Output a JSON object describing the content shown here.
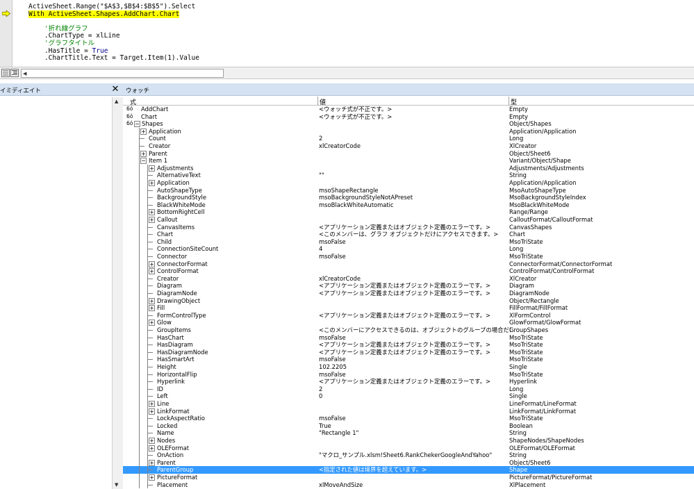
{
  "code": {
    "lines": [
      {
        "text": "ActiveSheet.Range(\"$A$3,$B$4:$B$5\").Select",
        "kind": "normal",
        "indent": 0
      },
      {
        "text": "With ActiveSheet.Shapes.AddChart.Chart",
        "kind": "highlight",
        "indent": 0
      },
      {
        "text": "",
        "kind": "normal",
        "indent": 0
      },
      {
        "text": "'折れ線グラフ",
        "kind": "comment",
        "indent": 4
      },
      {
        "text": ".ChartType = xlLine",
        "kind": "normal",
        "indent": 4
      },
      {
        "text": "'グラフタイトル",
        "kind": "comment",
        "indent": 4
      },
      {
        "text": ".HasTitle = True",
        "kind": "hastitle",
        "indent": 4
      },
      {
        "text": ".ChartTitle.Text = Target.Item(1).Value",
        "kind": "normal",
        "indent": 4
      }
    ],
    "exec_arrow_color": "#ffff00"
  },
  "immediate": {
    "title": "イミディエイト",
    "close_glyph": "✕"
  },
  "watch": {
    "title": "ウォッチ",
    "columns": [
      "式",
      "値",
      "型"
    ],
    "selected_color": "#3399ff",
    "rows": [
      {
        "expr": "AddChart",
        "value": "<ウォッチ式が不正です。>",
        "type": "Empty",
        "depth": 0,
        "icon": "glasses",
        "box": ""
      },
      {
        "expr": "Chart",
        "value": "<ウォッチ式が不正です。>",
        "type": "Empty",
        "depth": 0,
        "icon": "glasses",
        "box": ""
      },
      {
        "expr": "Shapes",
        "value": "",
        "type": "Object/Shapes",
        "depth": 0,
        "icon": "glasses",
        "box": "−"
      },
      {
        "expr": "Application",
        "value": "",
        "type": "Application/Application",
        "depth": 1,
        "box": "+"
      },
      {
        "expr": "Count",
        "value": "2",
        "type": "Long",
        "depth": 1,
        "box": ""
      },
      {
        "expr": "Creator",
        "value": "xlCreatorCode",
        "type": "XlCreator",
        "depth": 1,
        "box": ""
      },
      {
        "expr": "Parent",
        "value": "",
        "type": "Object/Sheet6",
        "depth": 1,
        "box": "+"
      },
      {
        "expr": "Item 1",
        "value": "",
        "type": "Variant/Object/Shape",
        "depth": 1,
        "box": "−"
      },
      {
        "expr": "Adjustments",
        "value": "",
        "type": "Adjustments/Adjustments",
        "depth": 2,
        "box": "+"
      },
      {
        "expr": "AlternativeText",
        "value": "\"\"",
        "type": "String",
        "depth": 2,
        "box": ""
      },
      {
        "expr": "Application",
        "value": "",
        "type": "Application/Application",
        "depth": 2,
        "box": "+"
      },
      {
        "expr": "AutoShapeType",
        "value": "msoShapeRectangle",
        "type": "MsoAutoShapeType",
        "depth": 2,
        "box": ""
      },
      {
        "expr": "BackgroundStyle",
        "value": "msoBackgroundStyleNotAPreset",
        "type": "MsoBackgroundStyleIndex",
        "depth": 2,
        "box": ""
      },
      {
        "expr": "BlackWhiteMode",
        "value": "msoBlackWhiteAutomatic",
        "type": "MsoBlackWhiteMode",
        "depth": 2,
        "box": ""
      },
      {
        "expr": "BottomRightCell",
        "value": "",
        "type": "Range/Range",
        "depth": 2,
        "box": "+"
      },
      {
        "expr": "Callout",
        "value": "",
        "type": "CalloutFormat/CalloutFormat",
        "depth": 2,
        "box": "+"
      },
      {
        "expr": "CanvasItems",
        "value": "<アプリケーション定義またはオブジェクト定義のエラーです。>",
        "type": "CanvasShapes",
        "depth": 2,
        "box": ""
      },
      {
        "expr": "Chart",
        "value": "<このメンバーは、グラフ オブジェクトだけにアクセスできます。>",
        "type": "Chart",
        "depth": 2,
        "box": ""
      },
      {
        "expr": "Child",
        "value": "msoFalse",
        "type": "MsoTriState",
        "depth": 2,
        "box": ""
      },
      {
        "expr": "ConnectionSiteCount",
        "value": "4",
        "type": "Long",
        "depth": 2,
        "box": ""
      },
      {
        "expr": "Connector",
        "value": "msoFalse",
        "type": "MsoTriState",
        "depth": 2,
        "box": ""
      },
      {
        "expr": "ConnectorFormat",
        "value": "",
        "type": "ConnectorFormat/ConnectorFormat",
        "depth": 2,
        "box": "+"
      },
      {
        "expr": "ControlFormat",
        "value": "",
        "type": "ControlFormat/ControlFormat",
        "depth": 2,
        "box": "+"
      },
      {
        "expr": "Creator",
        "value": "xlCreatorCode",
        "type": "XlCreator",
        "depth": 2,
        "box": ""
      },
      {
        "expr": "Diagram",
        "value": "<アプリケーション定義またはオブジェクト定義のエラーです。>",
        "type": "Diagram",
        "depth": 2,
        "box": ""
      },
      {
        "expr": "DiagramNode",
        "value": "<アプリケーション定義またはオブジェクト定義のエラーです。>",
        "type": "DiagramNode",
        "depth": 2,
        "box": ""
      },
      {
        "expr": "DrawingObject",
        "value": "",
        "type": "Object/Rectangle",
        "depth": 2,
        "box": "+"
      },
      {
        "expr": "Fill",
        "value": "",
        "type": "FillFormat/FillFormat",
        "depth": 2,
        "box": "+"
      },
      {
        "expr": "FormControlType",
        "value": "<アプリケーション定義またはオブジェクト定義のエラーです。>",
        "type": "XlFormControl",
        "depth": 2,
        "box": ""
      },
      {
        "expr": "Glow",
        "value": "",
        "type": "GlowFormat/GlowFormat",
        "depth": 2,
        "box": "+"
      },
      {
        "expr": "GroupItems",
        "value": "<このメンバーにアクセスできるのは、オブジェクトのグループの場合だけ",
        "type": "GroupShapes",
        "depth": 2,
        "box": ""
      },
      {
        "expr": "HasChart",
        "value": "msoFalse",
        "type": "MsoTriState",
        "depth": 2,
        "box": ""
      },
      {
        "expr": "HasDiagram",
        "value": "<アプリケーション定義またはオブジェクト定義のエラーです。>",
        "type": "MsoTriState",
        "depth": 2,
        "box": ""
      },
      {
        "expr": "HasDiagramNode",
        "value": "<アプリケーション定義またはオブジェクト定義のエラーです。>",
        "type": "MsoTriState",
        "depth": 2,
        "box": ""
      },
      {
        "expr": "HasSmartArt",
        "value": "msoFalse",
        "type": "MsoTriState",
        "depth": 2,
        "box": ""
      },
      {
        "expr": "Height",
        "value": "102.2205",
        "type": "Single",
        "depth": 2,
        "box": ""
      },
      {
        "expr": "HorizontalFlip",
        "value": "msoFalse",
        "type": "MsoTriState",
        "depth": 2,
        "box": ""
      },
      {
        "expr": "Hyperlink",
        "value": "<アプリケーション定義またはオブジェクト定義のエラーです。>",
        "type": "Hyperlink",
        "depth": 2,
        "box": ""
      },
      {
        "expr": "ID",
        "value": "2",
        "type": "Long",
        "depth": 2,
        "box": ""
      },
      {
        "expr": "Left",
        "value": "0",
        "type": "Single",
        "depth": 2,
        "box": ""
      },
      {
        "expr": "Line",
        "value": "",
        "type": "LineFormat/LineFormat",
        "depth": 2,
        "box": "+"
      },
      {
        "expr": "LinkFormat",
        "value": "",
        "type": "LinkFormat/LinkFormat",
        "depth": 2,
        "box": "+"
      },
      {
        "expr": "LockAspectRatio",
        "value": "msoFalse",
        "type": "MsoTriState",
        "depth": 2,
        "box": ""
      },
      {
        "expr": "Locked",
        "value": "True",
        "type": "Boolean",
        "depth": 2,
        "box": ""
      },
      {
        "expr": "Name",
        "value": "\"Rectangle 1\"",
        "type": "String",
        "depth": 2,
        "box": ""
      },
      {
        "expr": "Nodes",
        "value": "",
        "type": "ShapeNodes/ShapeNodes",
        "depth": 2,
        "box": "+"
      },
      {
        "expr": "OLEFormat",
        "value": "",
        "type": "OLEFormat/OLEFormat",
        "depth": 2,
        "box": "+"
      },
      {
        "expr": "OnAction",
        "value": "\"マクロ_サンプル.xlsm!Sheet6.RankChekerGoogleAndYahoo\"",
        "type": "String",
        "depth": 2,
        "box": ""
      },
      {
        "expr": "Parent",
        "value": "",
        "type": "Object/Sheet6",
        "depth": 2,
        "box": "+"
      },
      {
        "expr": "ParentGroup",
        "value": "<指定された値は境界を超えています。>",
        "type": "Shape",
        "depth": 2,
        "box": "",
        "selected": true
      },
      {
        "expr": "PictureFormat",
        "value": "",
        "type": "PictureFormat/PictureFormat",
        "depth": 2,
        "box": "+"
      },
      {
        "expr": "Placement",
        "value": "xlMoveAndSize",
        "type": "XlPlacement",
        "depth": 2,
        "box": ""
      }
    ]
  }
}
